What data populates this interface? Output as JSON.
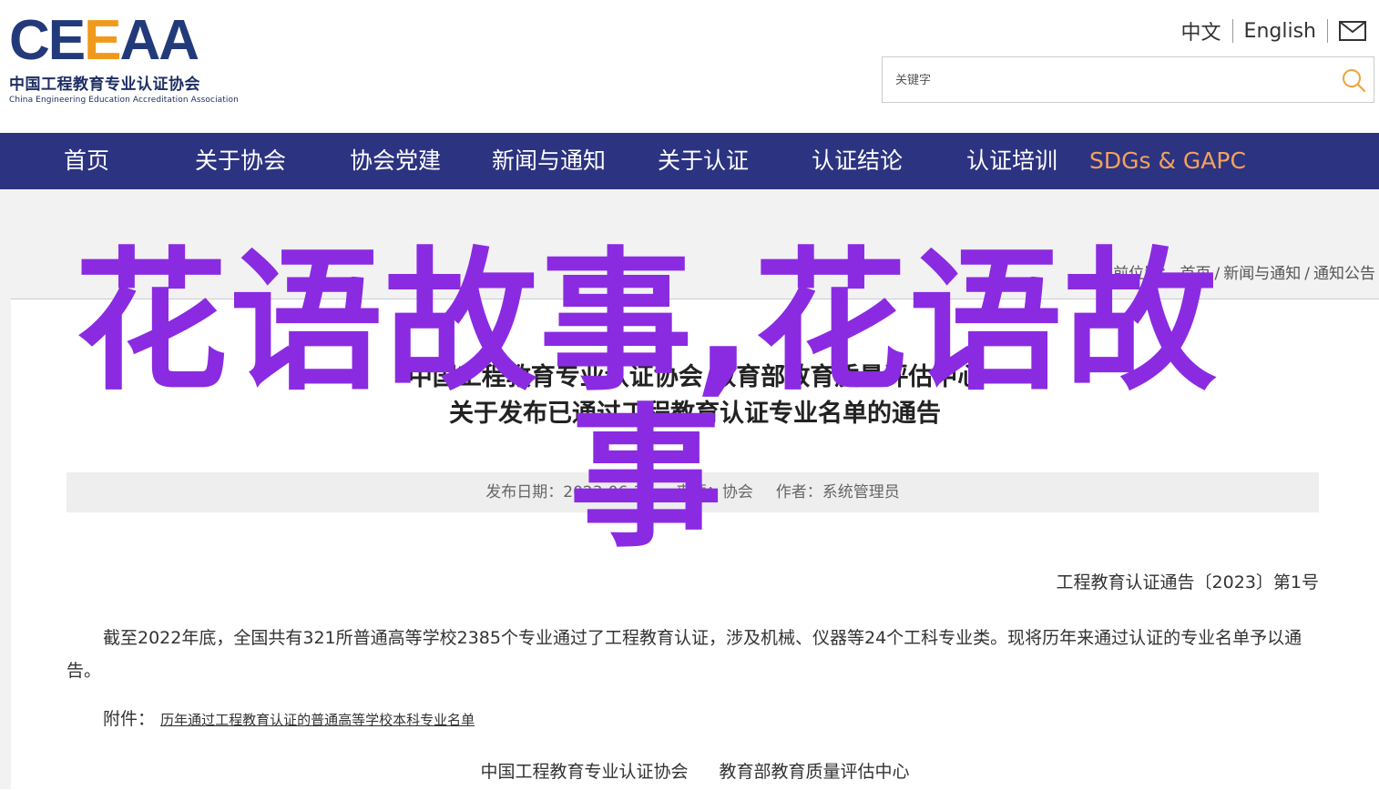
{
  "header": {
    "logo": {
      "mark_main": "CE",
      "mark_accent": "E",
      "mark_tail": "AA",
      "name_cn": "中国工程教育专业认证协会",
      "name_en": "China Engineering Education Accreditation Association"
    },
    "lang": {
      "zh_label": "中文",
      "en_label": "English",
      "mail_icon": "mail-icon"
    },
    "search": {
      "placeholder": "关键字",
      "icon": "search-icon"
    }
  },
  "nav": {
    "items": [
      {
        "label": "首页"
      },
      {
        "label": "关于协会"
      },
      {
        "label": "协会党建"
      },
      {
        "label": "新闻与通知"
      },
      {
        "label": "关于认证"
      },
      {
        "label": "认证结论"
      },
      {
        "label": "认证培训"
      },
      {
        "label": "SDGs & GAPC"
      }
    ],
    "highlight_color": "#f5a25d"
  },
  "breadcrumb": {
    "prefix": "当前位置：",
    "items": [
      "首页",
      "新闻与通知",
      "通知公告"
    ]
  },
  "article": {
    "title_line1": "中国工程教育专业认证协会 教育部教育质量评估中心",
    "title_line2": "关于发布已通过工程教育认证专业名单的通告",
    "meta": {
      "date_label": "发布日期：",
      "date_value": "2023-06-30",
      "source_label": "来源：协会",
      "author_label": "作者：",
      "author_value": "系统管理员"
    },
    "doc_number": "工程教育认证通告〔2023〕第1号",
    "body": "截至2022年底，全国共有321所普通高等学校2385个专业通过了工程教育认证，涉及机械、仪器等24个工科专业类。现将历年来通过认证的专业名单予以通告。",
    "attachment_label": "附件：",
    "attachment_link": "历年通过工程教育认证的普通高等学校本科专业名单",
    "signature_1": "中国工程教育专业认证协会",
    "signature_2": "教育部教育质量评估中心"
  },
  "watermark": {
    "text": "花语故事,花语故事",
    "color": "#8a2be2"
  },
  "colors": {
    "nav_bg": "#2c3380",
    "logo_blue": "#233a7a",
    "logo_orange": "#f09a1b",
    "search_icon": "#f0a33a"
  }
}
